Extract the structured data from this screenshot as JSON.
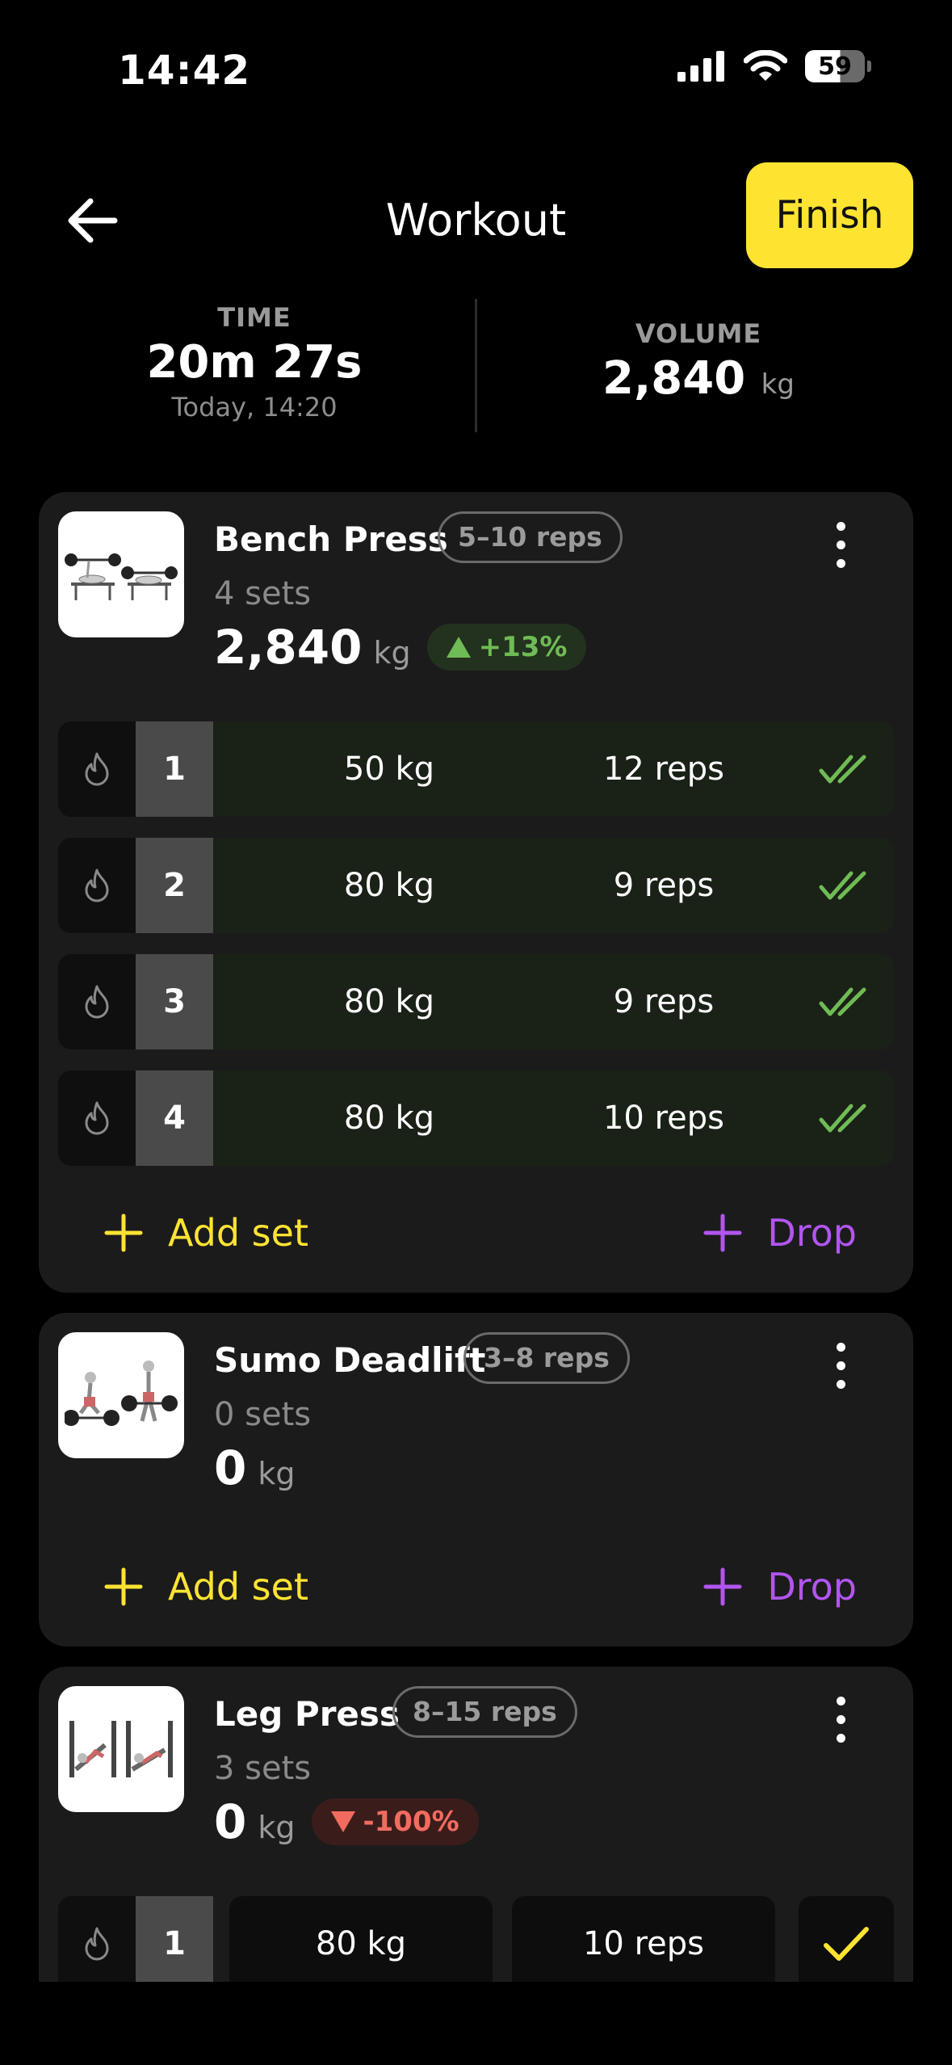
{
  "status_bar": {
    "time": "14:42",
    "battery": "59"
  },
  "header": {
    "title": "Workout",
    "finish_label": "Finish"
  },
  "summary": {
    "time_label": "TIME",
    "time_value": "20m 27s",
    "time_sub": "Today, 14:20",
    "volume_label": "VOLUME",
    "volume_value": "2,840",
    "volume_unit": "kg"
  },
  "colors": {
    "accent_yellow": "#ffe331",
    "accent_purple": "#b255f0",
    "success_green": "#6fbb55",
    "danger_red": "#f26b5f"
  },
  "exercises": [
    {
      "name": "Bench Press",
      "reps_range": "5–10 reps",
      "sets_count": "4 sets",
      "volume": "2,840",
      "volume_unit": "kg",
      "delta": "+13%",
      "delta_dir": "up",
      "sets": [
        {
          "number": "1",
          "weight": "50 kg",
          "reps": "12 reps",
          "done": true
        },
        {
          "number": "2",
          "weight": "80 kg",
          "reps": "9 reps",
          "done": true
        },
        {
          "number": "3",
          "weight": "80 kg",
          "reps": "9 reps",
          "done": true
        },
        {
          "number": "4",
          "weight": "80 kg",
          "reps": "10 reps",
          "done": true
        }
      ],
      "add_set_label": "Add set",
      "drop_label": "Drop"
    },
    {
      "name": "Sumo Deadlift",
      "reps_range": "3–8 reps",
      "sets_count": "0 sets",
      "volume": "0",
      "volume_unit": "kg",
      "sets": [],
      "add_set_label": "Add set",
      "drop_label": "Drop"
    },
    {
      "name": "Leg Press",
      "reps_range": "8–15 reps",
      "sets_count": "3 sets",
      "volume": "0",
      "volume_unit": "kg",
      "delta": "-100%",
      "delta_dir": "down",
      "sets": [
        {
          "number": "1",
          "weight": "80 kg",
          "reps": "10 reps",
          "done": false
        }
      ]
    }
  ]
}
